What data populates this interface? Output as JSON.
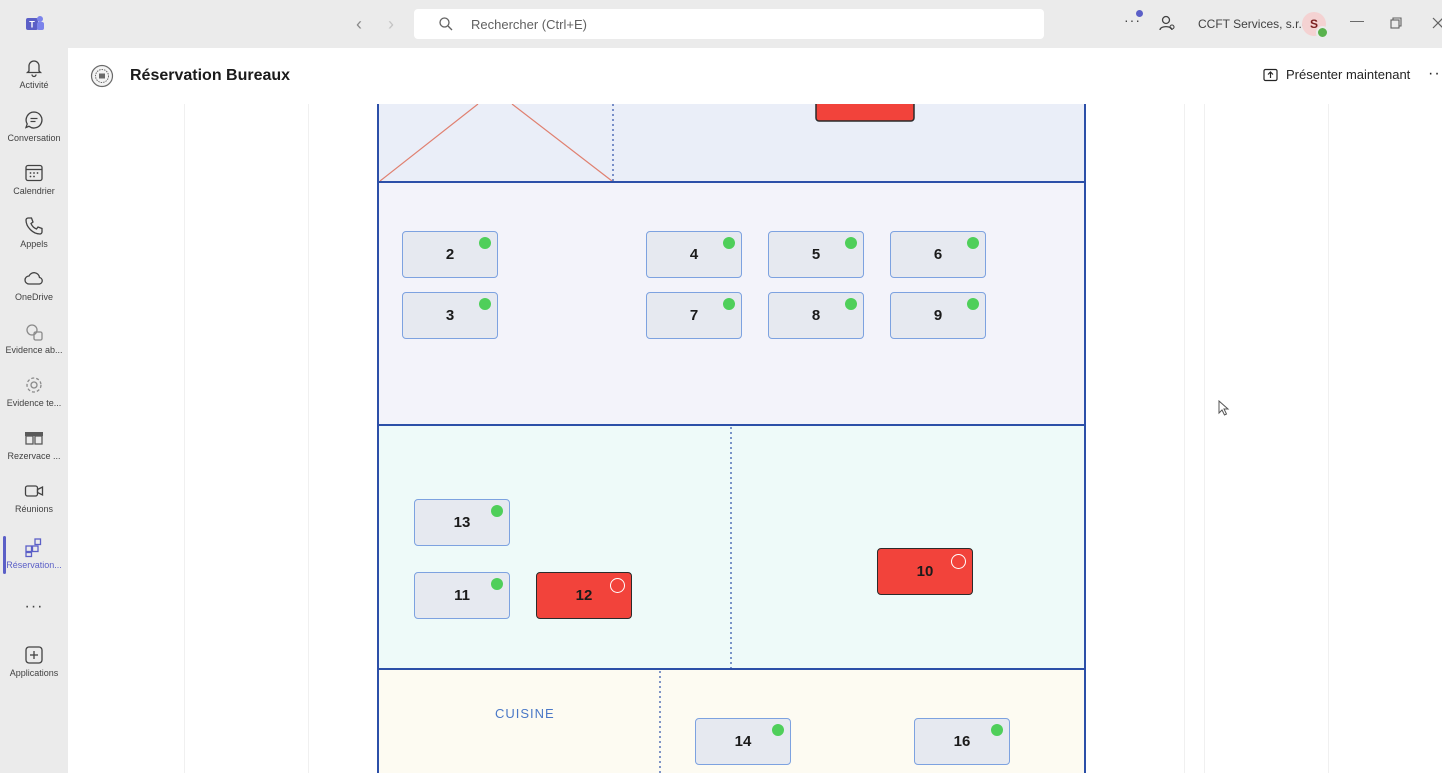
{
  "titlebar": {
    "search_placeholder": "Rechercher (Ctrl+E)",
    "org_name": "CCFT Services, s.r.o.",
    "avatar_initial": "S"
  },
  "rail": {
    "items": [
      {
        "label": "Activité",
        "icon": "bell-icon"
      },
      {
        "label": "Conversation",
        "icon": "chat-icon"
      },
      {
        "label": "Calendrier",
        "icon": "calendar-icon"
      },
      {
        "label": "Appels",
        "icon": "phone-icon"
      },
      {
        "label": "OneDrive",
        "icon": "cloud-icon"
      },
      {
        "label": "Evidence ab...",
        "icon": "evidence-icon"
      },
      {
        "label": "Evidence te...",
        "icon": "gear-icon"
      },
      {
        "label": "Rezervace ...",
        "icon": "table-icon"
      },
      {
        "label": "Réunions",
        "icon": "video-icon"
      },
      {
        "label": "Réservation...",
        "icon": "apps-icon"
      },
      {
        "label": "",
        "icon": "more-icon"
      },
      {
        "label": "Applications",
        "icon": "add-icon"
      }
    ],
    "active": "Réservation..."
  },
  "app": {
    "title": "Réservation Bureaux",
    "present_label": "Présenter maintenant",
    "more": "···"
  },
  "floorplan": {
    "kitchen_label": "CUISINE",
    "colors": {
      "free": "#4fcf5a",
      "occupied": "#f2433b",
      "wall": "#2c4fa8",
      "desk_border": "#7da2e0"
    },
    "desks": [
      {
        "number": "2",
        "status": "free"
      },
      {
        "number": "3",
        "status": "free"
      },
      {
        "number": "4",
        "status": "free"
      },
      {
        "number": "5",
        "status": "free"
      },
      {
        "number": "6",
        "status": "free"
      },
      {
        "number": "7",
        "status": "free"
      },
      {
        "number": "8",
        "status": "free"
      },
      {
        "number": "9",
        "status": "free"
      },
      {
        "number": "13",
        "status": "free"
      },
      {
        "number": "11",
        "status": "free"
      },
      {
        "number": "12",
        "status": "occupied"
      },
      {
        "number": "10",
        "status": "occupied"
      },
      {
        "number": "14",
        "status": "free"
      },
      {
        "number": "16",
        "status": "free"
      }
    ]
  }
}
